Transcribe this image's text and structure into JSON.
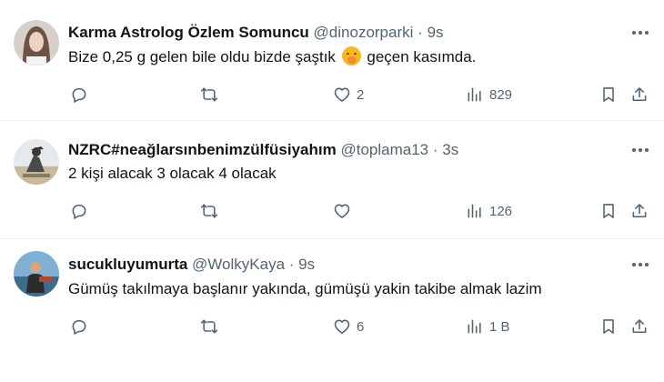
{
  "tweets": [
    {
      "name": "Karma Astrolog Özlem Somuncu",
      "handle": "@dinozorparki",
      "separator": "·",
      "time": "9s",
      "text_before": "Bize 0,25 g gelen bile oldu bizde şaştık",
      "emoji": "hand-over-mouth-emoji",
      "text_after": "geçen kasımda.",
      "likes": "2",
      "views": "829",
      "replies": "",
      "retweets": ""
    },
    {
      "name": "NZRC#neağlarsınbenimzülfüsiyahım",
      "handle": "@toplama13",
      "separator": "·",
      "time": "3s",
      "text_before": "2 kişi alacak 3 olacak 4 olacak",
      "emoji": "",
      "text_after": "",
      "likes": "",
      "views": "126",
      "replies": "",
      "retweets": ""
    },
    {
      "name": "sucukluyumurta",
      "handle": "@WolkyKaya",
      "separator": "·",
      "time": "9s",
      "text_before": "Gümüş takılmaya başlanır yakında, gümüşü yakin takibe almak lazim",
      "emoji": "",
      "text_after": "",
      "likes": "6",
      "views": "1 B",
      "replies": "",
      "retweets": ""
    }
  ],
  "icons": {
    "reply": "reply-icon",
    "retweet": "retweet-icon",
    "like": "heart-icon",
    "views": "views-chart-icon",
    "bookmark": "bookmark-icon",
    "share": "share-icon",
    "more": "more-dots-icon"
  },
  "colors": {
    "text": "#0f1419",
    "secondary": "#536471",
    "border": "#eff3f4"
  }
}
